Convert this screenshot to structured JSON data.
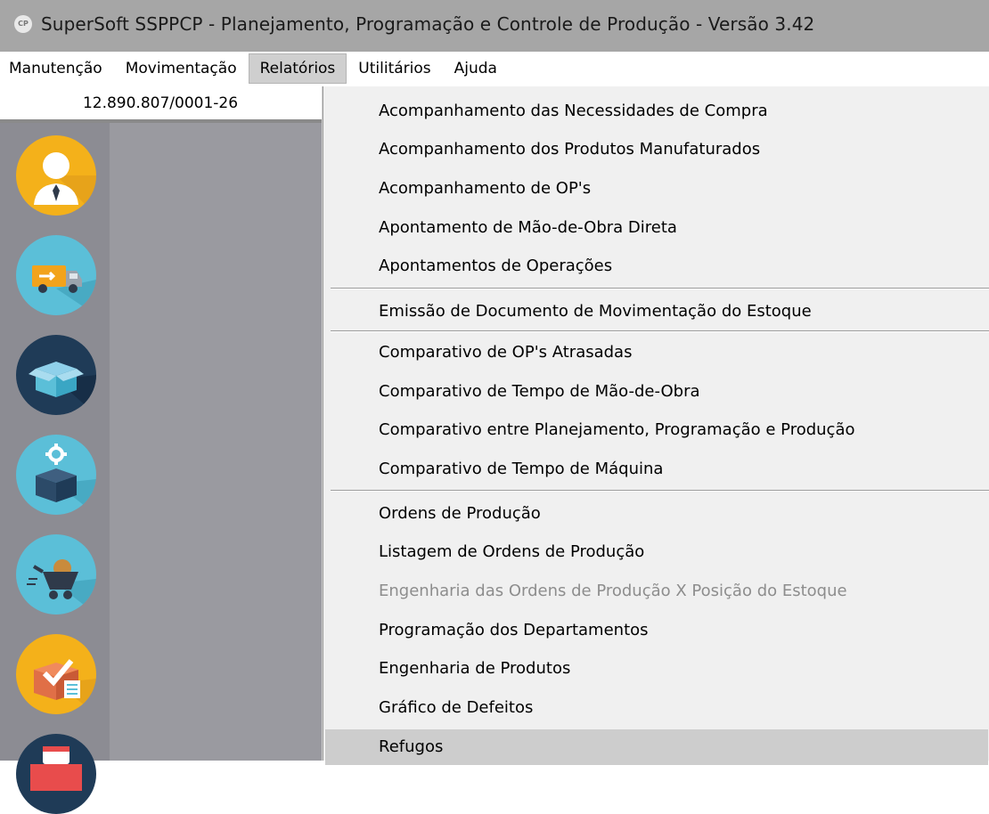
{
  "window": {
    "title": "SuperSoft SSPPCP - Planejamento, Programação e Controle de Produção - Versão 3.42",
    "icon": "app-logo-icon",
    "icon_text": "CP"
  },
  "menubar": [
    {
      "label": "Manutenção",
      "active": false
    },
    {
      "label": "Movimentação",
      "active": false
    },
    {
      "label": "Relatórios",
      "active": true
    },
    {
      "label": "Utilitários",
      "active": false
    },
    {
      "label": "Ajuda",
      "active": false
    }
  ],
  "company": {
    "cnpj": "12.890.807/0001-26"
  },
  "sidebar": {
    "icons": [
      "user-manager-icon",
      "delivery-truck-icon",
      "open-box-icon",
      "box-gear-icon",
      "wheelbarrow-icon",
      "checklist-box-icon",
      "calendar-box-icon"
    ]
  },
  "dropdown": {
    "items": [
      {
        "label": "Acompanhamento das Necessidades de Compra",
        "disabled": false
      },
      {
        "label": "Acompanhamento dos Produtos Manufaturados",
        "disabled": false
      },
      {
        "label": "Acompanhamento de OP's",
        "disabled": false
      },
      {
        "label": "Apontamento de Mão-de-Obra Direta",
        "disabled": false
      },
      {
        "label": "Apontamentos de Operações",
        "disabled": false
      },
      {
        "label": "Emissão de Documento de Movimentação do Estoque",
        "disabled": false
      },
      {
        "label": "Comparativo de OP's Atrasadas",
        "disabled": false
      },
      {
        "label": "Comparativo de Tempo de Mão-de-Obra",
        "disabled": false
      },
      {
        "label": "Comparativo entre Planejamento, Programação e Produção",
        "disabled": false
      },
      {
        "label": "Comparativo de Tempo de Máquina",
        "disabled": false
      },
      {
        "label": "Ordens de Produção",
        "disabled": false
      },
      {
        "label": "Listagem de Ordens de Produção",
        "disabled": false
      },
      {
        "label": "Engenharia das Ordens de Produção X Posição do Estoque",
        "disabled": true
      },
      {
        "label": "Programação dos Departamentos",
        "disabled": false
      },
      {
        "label": "Engenharia de Produtos",
        "disabled": false
      },
      {
        "label": "Gráfico de Defeitos",
        "disabled": false
      },
      {
        "label": "Refugos",
        "disabled": false,
        "highlighted": true
      }
    ]
  },
  "colors": {
    "titlebar": "#a6a6a6",
    "sidebar": "#8c8c93",
    "menu_bg": "#f0f0f0",
    "menu_highlight": "#cdcdcd",
    "disabled_text": "#8d8d8d"
  }
}
